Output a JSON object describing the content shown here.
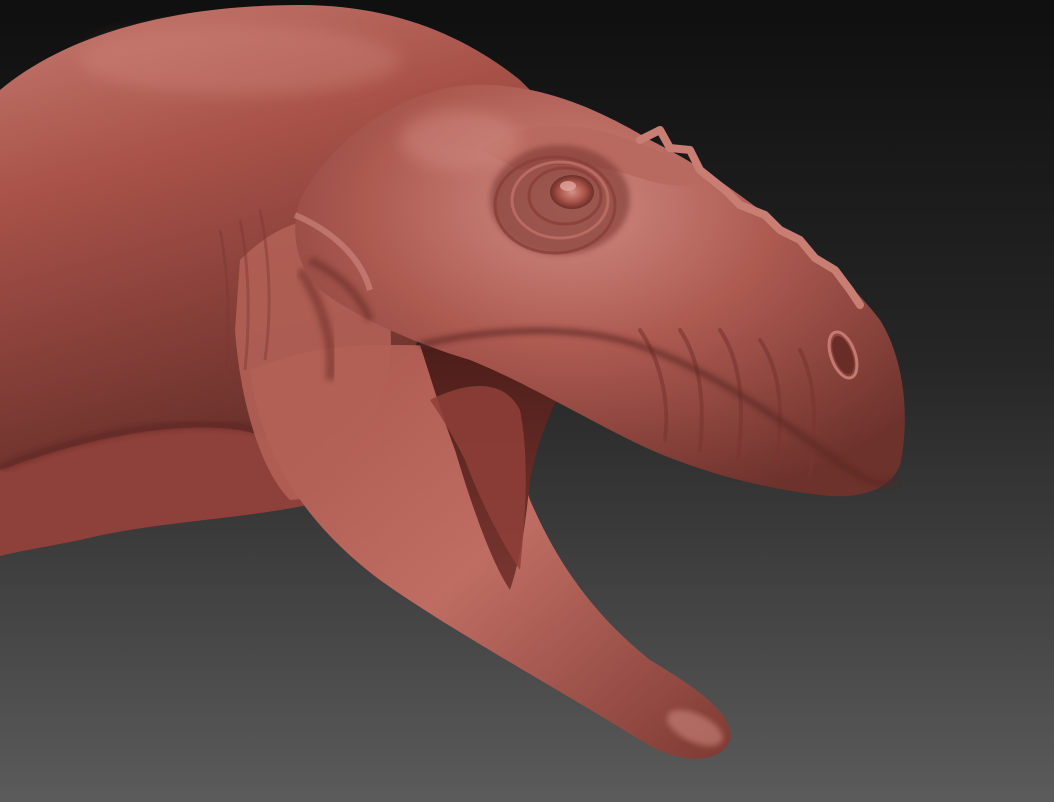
{
  "scene": {
    "subject_icon": "dinosaur-head-sculpt-icon",
    "colors": {
      "background_top": "#0f0f0f",
      "background_bottom": "#5b5b5b",
      "clay_base": "#9e4a42",
      "clay_highlight": "#c57a70",
      "clay_shadow": "#5e2a25",
      "clay_deep": "#3c1714"
    }
  }
}
